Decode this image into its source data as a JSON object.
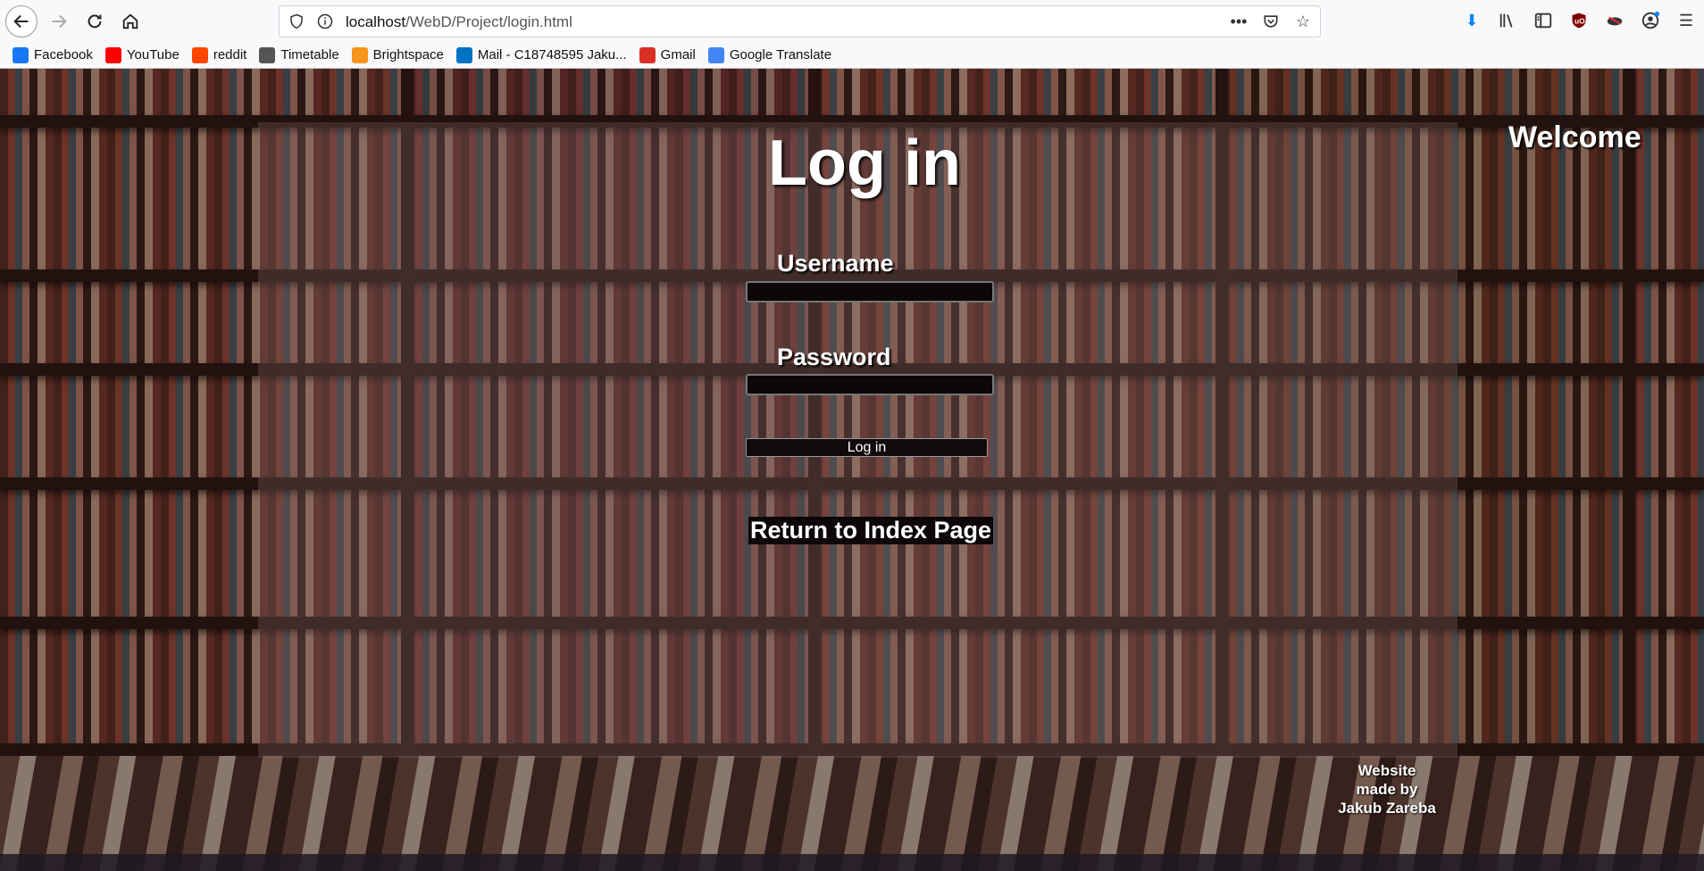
{
  "browser": {
    "url_host": "localhost",
    "url_path": "/WebD/Project/login.html",
    "bookmarks": [
      {
        "label": "Facebook",
        "icon": "facebook-icon",
        "color": "#1877f2"
      },
      {
        "label": "YouTube",
        "icon": "youtube-icon",
        "color": "#ff0000"
      },
      {
        "label": "reddit",
        "icon": "reddit-icon",
        "color": "#ff4500"
      },
      {
        "label": "Timetable",
        "icon": "globe-icon",
        "color": "#555555"
      },
      {
        "label": "Brightspace",
        "icon": "brightspace-icon",
        "color": "#f7941d"
      },
      {
        "label": "Mail - C18748595 Jaku...",
        "icon": "outlook-icon",
        "color": "#0072c6"
      },
      {
        "label": "Gmail",
        "icon": "gmail-icon",
        "color": "#d93025"
      },
      {
        "label": "Google Translate",
        "icon": "translate-icon",
        "color": "#4285f4"
      }
    ]
  },
  "page": {
    "title": "Log in",
    "welcome": "Welcome",
    "username_label": "Username",
    "password_label": "Password",
    "login_button": "Log in",
    "return_link": "Return to Index Page",
    "credit": [
      "Website",
      "made by",
      "Jakub Zareba"
    ]
  }
}
